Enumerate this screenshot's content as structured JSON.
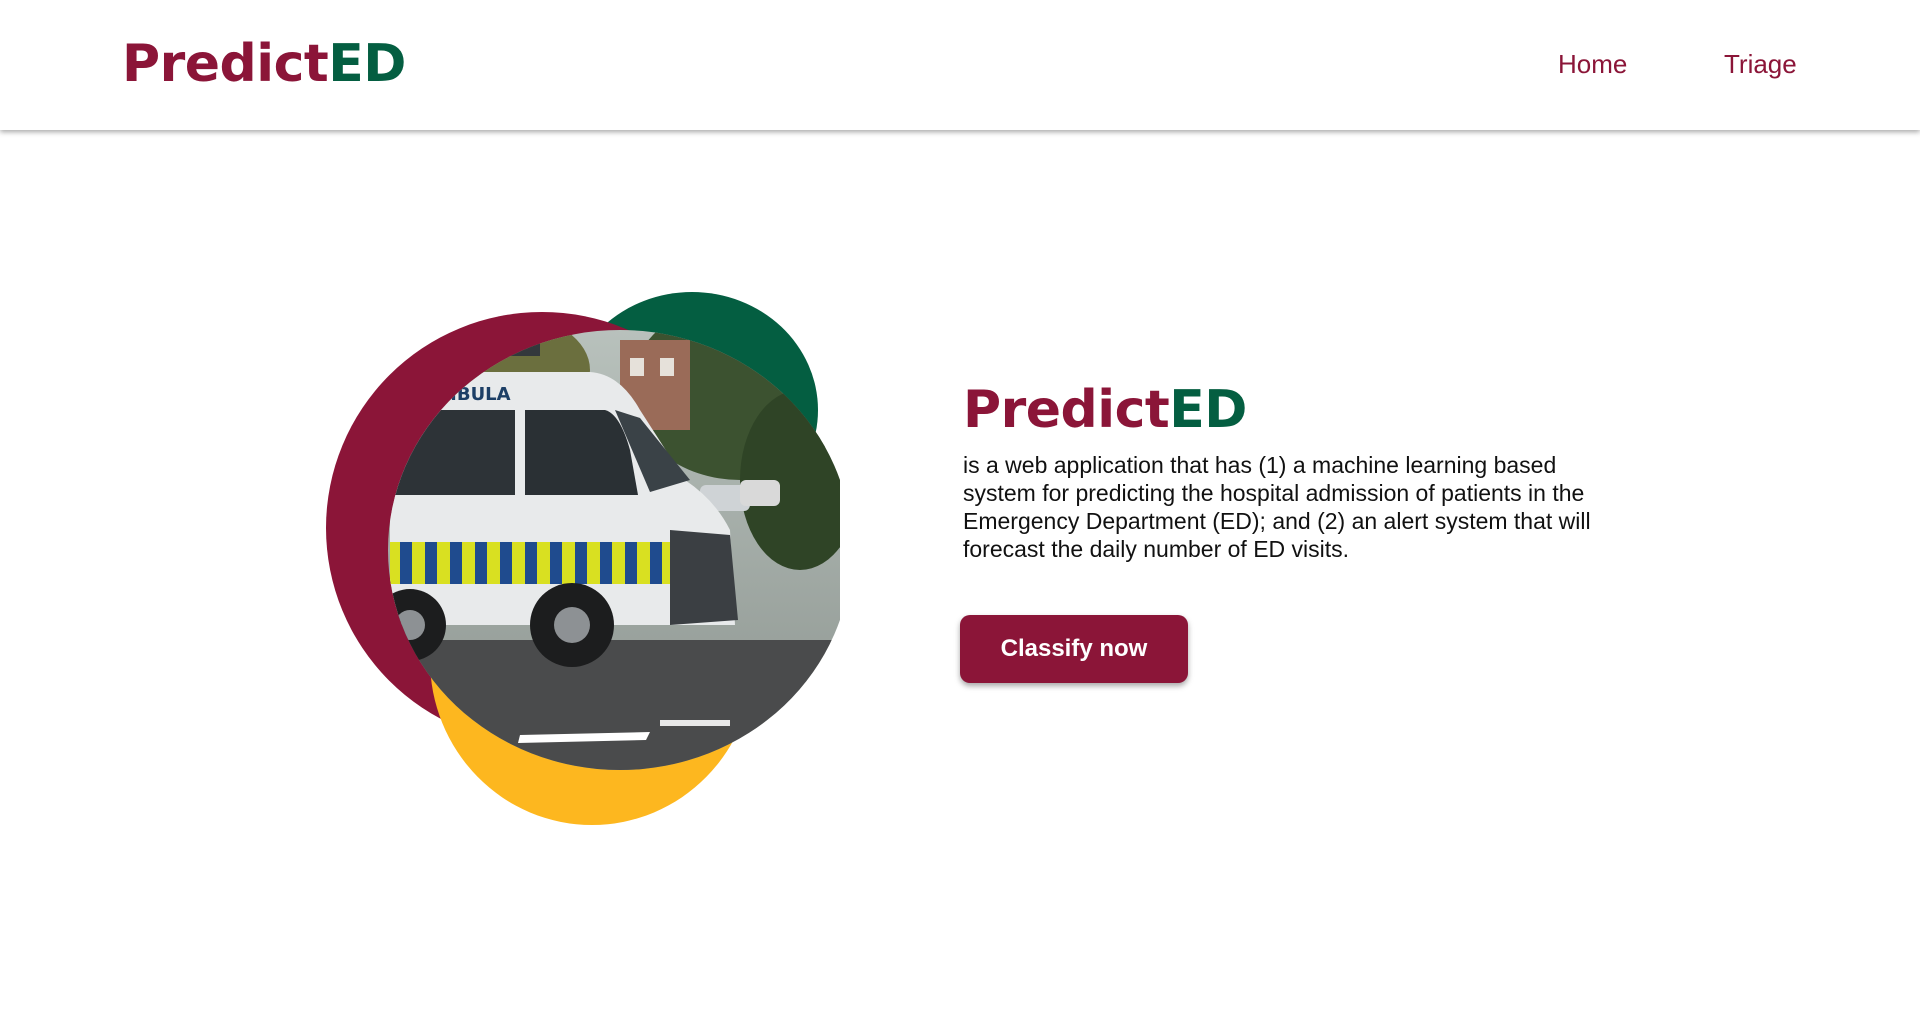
{
  "header": {
    "logo": {
      "part1": "Predict",
      "part2": "ED"
    },
    "nav": [
      {
        "label": "Home"
      },
      {
        "label": "Triage"
      }
    ]
  },
  "hero": {
    "title": {
      "part1": "Predict",
      "part2": "ED"
    },
    "description": "is a web application that has (1) a machine learning based system for predicting the hospital admission of patients in the Emergency Department (ED); and (2) an alert system that will forecast the daily number of ED visits.",
    "cta_label": "Classify now",
    "image_text": "AMBULA",
    "image_subject": "ambulance-photo"
  },
  "colors": {
    "brand_red": "#8b1538",
    "brand_green": "#045e41",
    "accent_yellow": "#fdb71f"
  }
}
